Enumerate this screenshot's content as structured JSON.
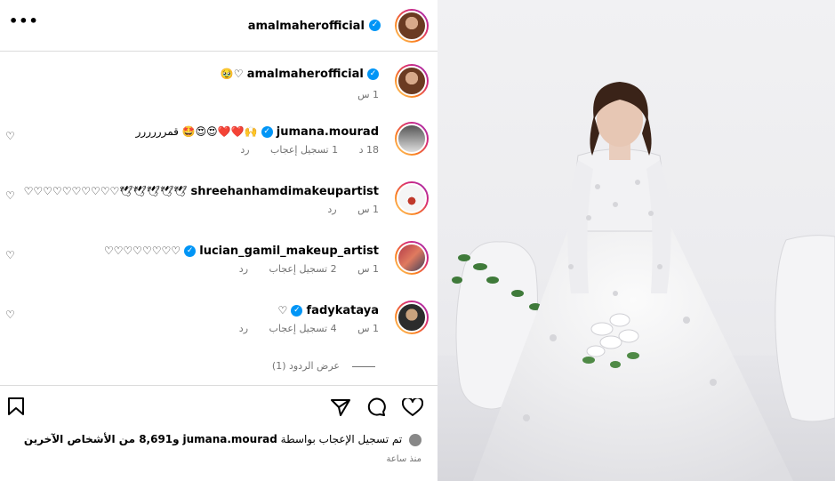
{
  "header": {
    "more_label": "•••",
    "username": "amalmaherofficial"
  },
  "comments": [
    {
      "username": "amalmaherofficial",
      "text": "🥹♡",
      "time": "1 س",
      "likes": "",
      "reply": ""
    },
    {
      "username": "jumana.mourad",
      "text": "قمرررررر 🤩😍😍❤️❤️🙌",
      "time": "18 د",
      "likes": "1 تسجيل إعجاب",
      "reply": "رد"
    },
    {
      "username": "shreehanhamdimakeupartist",
      "text": "♡♡♡♡♡♡♡♡♡♡🕊🕊🕊🕊🕊",
      "time": "1 س",
      "likes": "",
      "reply": "رد"
    },
    {
      "username": "lucian_gamil_makeup_artist",
      "text": "♡♡♡♡♡♡♡♡",
      "time": "1 س",
      "likes": "2 تسجيل إعجاب",
      "reply": "رد"
    },
    {
      "username": "fadykataya",
      "text": "♡",
      "time": "1 س",
      "likes": "4 تسجيل إعجاب",
      "reply": "رد"
    }
  ],
  "replies_link": "عرض الردود (1)",
  "likes_summary": {
    "prefix": "تم تسجيل الإعجاب بواسطة",
    "user": "jumana.mourad",
    "suffix": "و8,691 من الأشخاص الآخرين"
  },
  "posted_ago": "منذ ساعة",
  "icons": {
    "bookmark": "bookmark-icon",
    "share": "share-icon",
    "comment": "comment-icon",
    "like": "heart-icon",
    "verified": "verified-badge-icon"
  },
  "colors": {
    "verified": "#0095f6",
    "muted": "#737373",
    "border": "#dbdbdb"
  }
}
